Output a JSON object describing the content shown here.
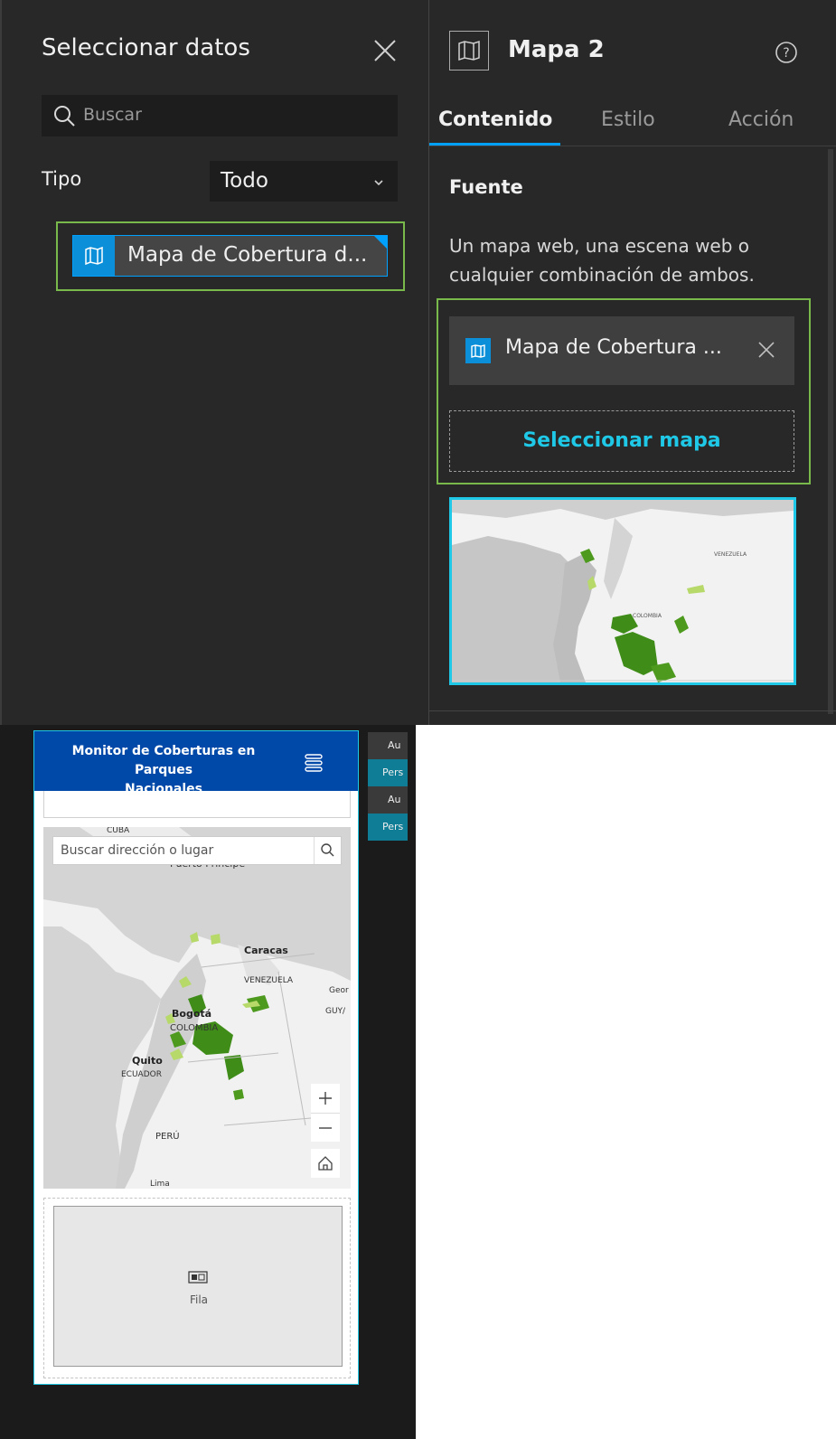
{
  "select_data": {
    "title": "Seleccionar datos",
    "search_placeholder": "Buscar",
    "type_label": "Tipo",
    "type_value": "Todo",
    "item_label": "Mapa de Cobertura d..."
  },
  "map_settings": {
    "title": "Mapa 2",
    "tabs": [
      "Contenido",
      "Estilo",
      "Acción"
    ],
    "source_heading": "Fuente",
    "source_description": [
      "Un mapa web, una escena web o",
      "cualquier combinación de ambos."
    ],
    "selected_map": "Mapa de Cobertura ...",
    "select_map_button": "Seleccionar mapa",
    "thumbnail_labels": [
      "VENEZUELA",
      "COLOMBIA"
    ]
  },
  "preview": {
    "app_title_line1": "Monitor de Coberturas en Parques",
    "app_title_line2": "Nacionales",
    "search_placeholder": "Buscar dirección o lugar",
    "map_labels": {
      "cuba": "CUBA",
      "puerto_principe": "Puerto Principe",
      "caracas": "Caracas",
      "venezuela": "VENEZUELA",
      "georgetown": "Geor",
      "guyana": "GUY/",
      "bogota": "Bogotá",
      "colombia": "COLOMBIA",
      "quito": "Quito",
      "ecuador": "ECUADOR",
      "peru": "PERÚ",
      "lima": "Lima"
    },
    "row_label": "Fila",
    "side_tabs": [
      "Au",
      "Pers",
      "Au",
      "Pers"
    ]
  },
  "colors": {
    "panel_bg": "#282828",
    "accent_blue": "#00a0ff",
    "accent_cyan": "#1ec8e6",
    "highlight_green": "#79b84b",
    "app_header": "#0049a8",
    "teal_tab": "#0f7d95"
  },
  "icons": [
    "close-icon",
    "search-icon",
    "chevron-down-icon",
    "map-icon",
    "help-icon",
    "zoom-in-icon",
    "zoom-out-icon",
    "home-icon",
    "hamburger-icon",
    "row-icon"
  ]
}
